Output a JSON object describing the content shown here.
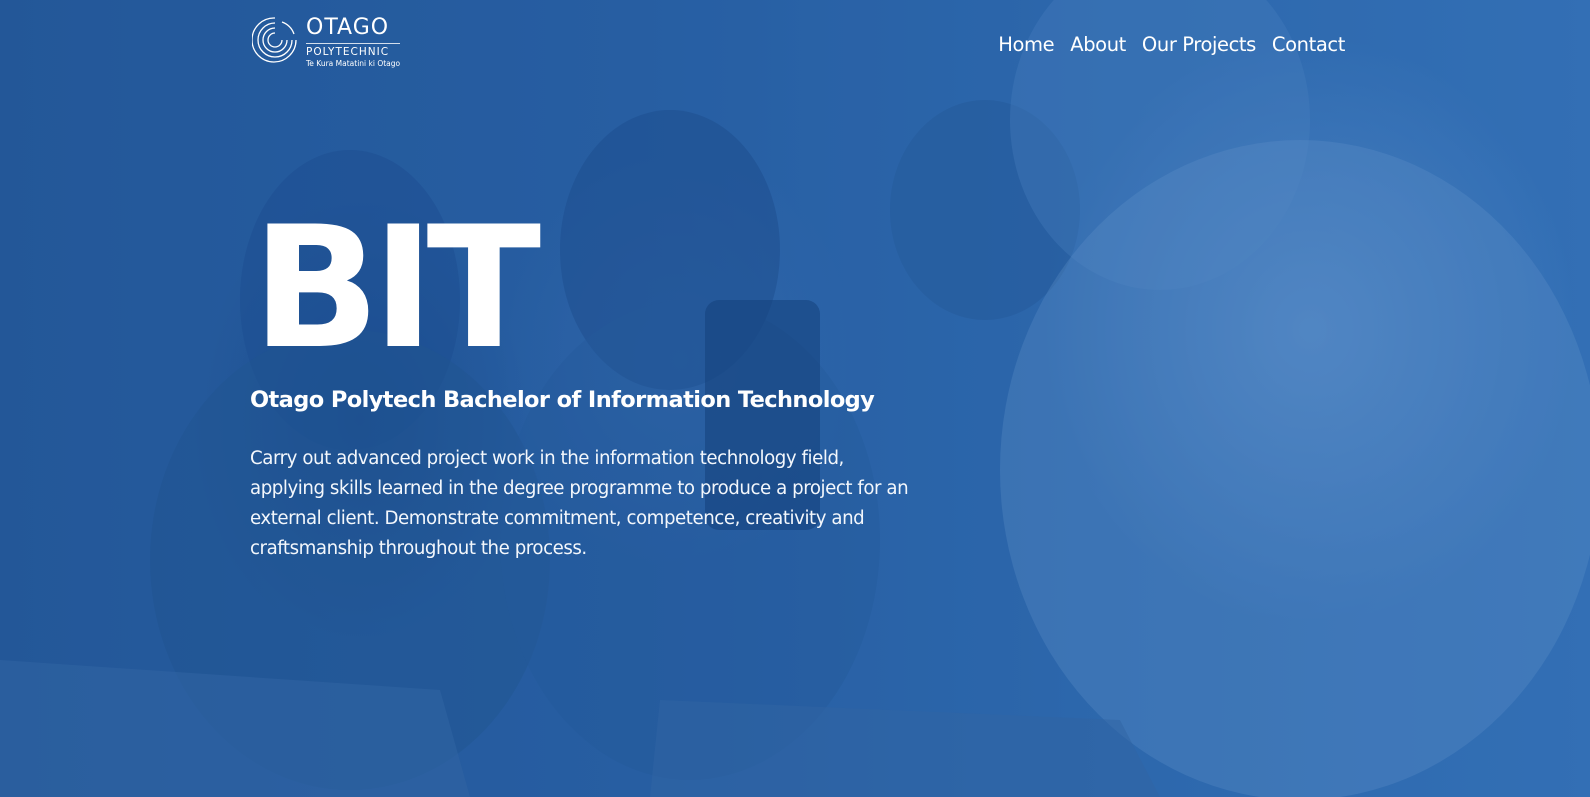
{
  "logo": {
    "name": "OTAGO",
    "sub": "POLYTECHNIC",
    "tagline": "Te Kura Matatini ki Otago"
  },
  "nav": {
    "items": [
      {
        "label": "Home"
      },
      {
        "label": "About"
      },
      {
        "label": "Our Projects"
      },
      {
        "label": "Contact"
      }
    ]
  },
  "hero": {
    "title": "BIT",
    "subtitle": "Otago Polytech Bachelor of Information Technology",
    "description": "Carry out advanced project work in the information technology field, applying skills learned in the degree programme to produce a project for an external client. Demonstrate commitment, competence, creativity and craftsmanship throughout the process."
  },
  "colors": {
    "overlay": "#2d62a3",
    "text": "#ffffff"
  }
}
